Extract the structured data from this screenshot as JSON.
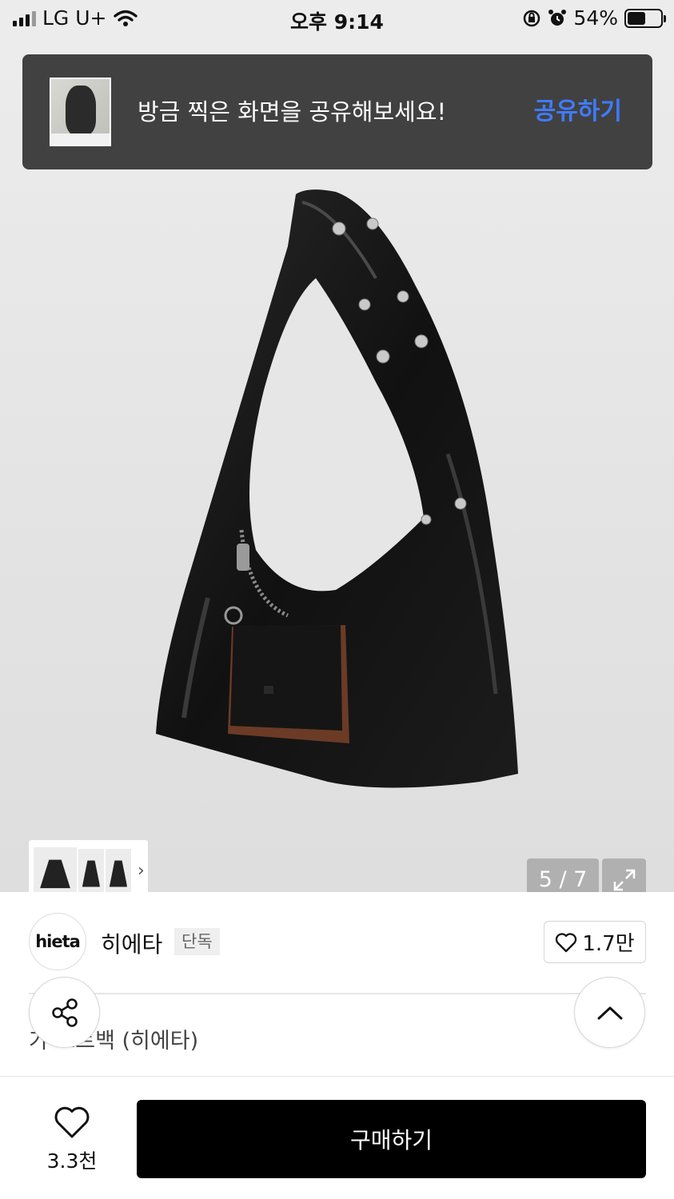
{
  "status_bar": {
    "carrier": "LG U+",
    "time": "오후 9:14",
    "battery": "54%"
  },
  "share_banner": {
    "message": "방금 찍은 화면을 공유해보세요!",
    "action": "공유하기"
  },
  "gallery": {
    "counter": "5 / 7",
    "thumbnails_more_icon": "chevron-right-icon",
    "expand_icon": "expand-icon"
  },
  "brand": {
    "logo_text": "hieta",
    "name": "히에타",
    "badge": "단독",
    "likes": "1.7만"
  },
  "product": {
    "name_visible": "가   토트백 (히에타)"
  },
  "bottom_bar": {
    "wish_count": "3.3천",
    "buy_label": "구매하기"
  },
  "colors": {
    "banner_bg": "#414141",
    "banner_action": "#3f7bff",
    "buy_button": "#000000"
  }
}
